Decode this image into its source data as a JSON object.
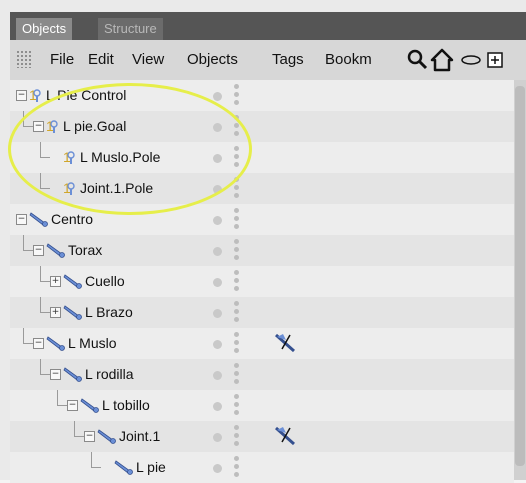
{
  "tabs": [
    {
      "label": "Objects",
      "active": true
    },
    {
      "label": "Structure",
      "active": false
    }
  ],
  "menu": [
    "File",
    "Edit",
    "View",
    "Objects",
    "Tags",
    "Bookm"
  ],
  "toolbar_icons": [
    "search-icon",
    "home-icon",
    "eye-icon",
    "add-layer-icon"
  ],
  "tree": [
    {
      "name": "L Pie Control",
      "depth": 0,
      "icon": "null-icon",
      "expand": "-",
      "tag": false
    },
    {
      "name": "L pie.Goal",
      "depth": 1,
      "icon": "null-icon",
      "expand": "-",
      "tag": false
    },
    {
      "name": "L Muslo.Pole",
      "depth": 2,
      "icon": "null-icon",
      "expand": "",
      "tag": false
    },
    {
      "name": "Joint.1.Pole",
      "depth": 2,
      "icon": "null-icon",
      "expand": "",
      "tag": false
    },
    {
      "name": "Centro",
      "depth": 0,
      "icon": "bone-icon",
      "expand": "-",
      "tag": false
    },
    {
      "name": "Torax",
      "depth": 1,
      "icon": "bone-icon",
      "expand": "-",
      "tag": false
    },
    {
      "name": "Cuello",
      "depth": 2,
      "icon": "bone-icon",
      "expand": "+",
      "tag": false
    },
    {
      "name": "L Brazo",
      "depth": 2,
      "icon": "bone-icon",
      "expand": "+",
      "tag": false
    },
    {
      "name": "L Muslo",
      "depth": 1,
      "icon": "bone-icon",
      "expand": "-",
      "tag": true
    },
    {
      "name": "L rodilla",
      "depth": 2,
      "icon": "bone-icon",
      "expand": "-",
      "tag": false
    },
    {
      "name": "L tobillo",
      "depth": 3,
      "icon": "bone-icon",
      "expand": "-",
      "tag": false
    },
    {
      "name": "Joint.1",
      "depth": 4,
      "icon": "bone-icon",
      "expand": "-",
      "tag": true
    },
    {
      "name": "L pie",
      "depth": 5,
      "icon": "bone-icon",
      "expand": "",
      "tag": false
    }
  ],
  "colors": {
    "highlight": "#e6ee4a",
    "icon_blue": "#6b8fd6",
    "tab_bar": "#555555"
  }
}
